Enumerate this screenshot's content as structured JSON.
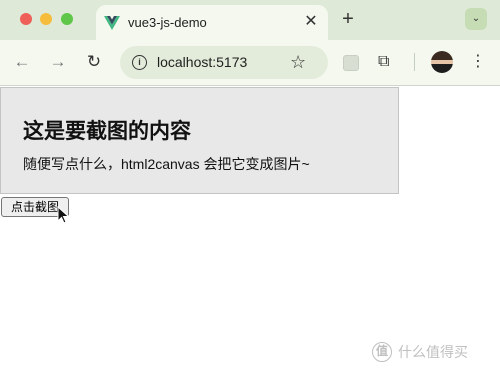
{
  "browser": {
    "tab": {
      "title": "vue3-js-demo",
      "close_glyph": "✕",
      "logo": "vue-logo-icon"
    },
    "new_tab_glyph": "+",
    "tab_search_glyph": "⌄",
    "nav": {
      "back_glyph": "←",
      "forward_glyph": "→",
      "reload_glyph": "↻"
    },
    "address": {
      "url": "localhost:5173",
      "info_glyph": "i"
    },
    "bookmark_glyph": "☆",
    "extensions_glyph": "⧉",
    "menu_glyph": "⋮"
  },
  "page": {
    "heading": "这是要截图的内容",
    "description": "随便写点什么，html2canvas 会把它变成图片~",
    "capture_button": "点击截图"
  },
  "watermark": {
    "logo_glyph": "值",
    "text": "什么值得买"
  },
  "colors": {
    "tab_strip": "#dfe9d7",
    "toolbar": "#f4f8ef",
    "content_bg": "#e8e8e8",
    "vue_green": "#41b883",
    "vue_dark": "#35495e"
  }
}
